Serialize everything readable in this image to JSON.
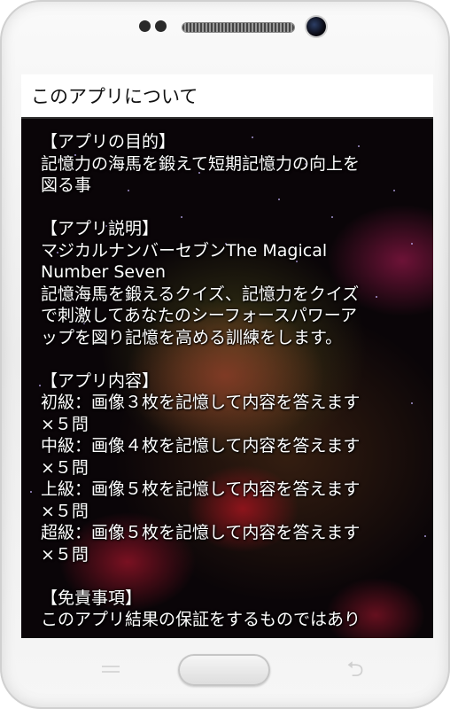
{
  "app_bar": {
    "title": "このアプリについて"
  },
  "content": {
    "lines": [
      "【アプリの目的】",
      "記憶力の海馬を鍛えて短期記憶力の向上を",
      "図る事",
      "",
      "【アプリ説明】",
      "マジカルナンバーセブンThe Magical",
      "Number Seven",
      "記憶海馬を鍛えるクイズ、記憶力をクイズ",
      "で刺激してあなたのシーフォースパワーア",
      "ップを図り記憶を高める訓練をします。",
      "",
      "【アプリ内容】",
      "初級：画像３枚を記憶して内容を答えます",
      "×５問",
      "中級：画像４枚を記憶して内容を答えます",
      "×５問",
      "上級：画像５枚を記憶して内容を答えます",
      "×５問",
      "超級：画像５枚を記憶して内容を答えます",
      "×５問",
      "",
      "【免責事項】",
      "このアプリ結果の保証をするものではあり"
    ]
  },
  "device": {
    "icons": [
      "front-sensor-icon",
      "earpiece-speaker-icon",
      "front-camera-icon",
      "menu-icon",
      "back-arrow-icon"
    ]
  }
}
